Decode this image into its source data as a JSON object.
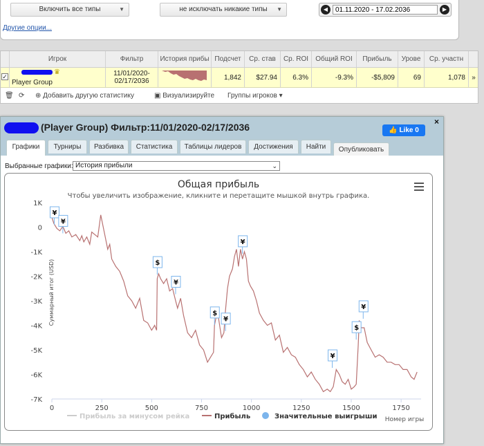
{
  "filters": {
    "types_label": "Включить все типы",
    "exclude_label": "не исключать никакие типы",
    "date_range": "01.11.2020 - 17.02.2036",
    "more_options": "Другие опции..."
  },
  "table": {
    "headers": [
      "Игрок",
      "Фильтр",
      "История прибы",
      "Подсчет",
      "Ср. став",
      "Ср. ROI",
      "Общий ROI",
      "Прибыль",
      "Урове",
      "Ср. участн"
    ],
    "row": {
      "player": "Player Group",
      "filter_line1": "11/01/2020-",
      "filter_line2": "02/17/2036",
      "count": "1,842",
      "avg_stake": "$27.94",
      "avg_roi": "6.3%",
      "total_roi": "-9.3%",
      "profit": "-$5,809",
      "level": "69",
      "avg_entrants": "1,078",
      "extra": "»"
    },
    "toolbar": {
      "add_stat": "Добавить другую статистику",
      "visualize": "Визуализируйте",
      "groups": "Группы игроков"
    }
  },
  "window": {
    "title": "(Player Group) Фильтр:11/01/2020-02/17/2036",
    "like_label": "Like 0",
    "close": "×",
    "tabs": [
      "Графики",
      "Турниры",
      "Разбивка",
      "Статистика",
      "Таблицы лидеров",
      "Достижения",
      "Найти"
    ],
    "publish": "Опубликовать",
    "selected_label": "Выбранные графики:",
    "selected_value": "История прибыли"
  },
  "colors": {
    "line": "#b87171",
    "rake_line": "#cccccc",
    "marker": "#7cb5ec",
    "accent": "#1877f2"
  },
  "chart_data": {
    "type": "line",
    "title": "Общая прибыль",
    "subtitle": "Чтобы увеличить изображение, кликните и перетащите мышкой внутрь графика.",
    "xlabel": "Номер игры",
    "ylabel": "Суммарный итог (USD)",
    "xlim": [
      0,
      1850
    ],
    "ylim": [
      -7000,
      1000
    ],
    "xticks": [
      "0",
      "250",
      "500",
      "750",
      "1000",
      "1250",
      "1500",
      "1750"
    ],
    "xtick_values": [
      0,
      250,
      500,
      750,
      1000,
      1250,
      1500,
      1750
    ],
    "yticks": [
      "1K",
      "0",
      "-1K",
      "-2K",
      "-3K",
      "-4K",
      "-5K",
      "-6K",
      "-7K"
    ],
    "ytick_values": [
      1000,
      0,
      -1000,
      -2000,
      -3000,
      -4000,
      -5000,
      -6000,
      -7000
    ],
    "series": [
      {
        "name": "Прибыль",
        "x": [
          0,
          10,
          25,
          40,
          55,
          70,
          85,
          100,
          120,
          140,
          150,
          160,
          175,
          190,
          200,
          215,
          230,
          245,
          255,
          265,
          280,
          290,
          300,
          320,
          340,
          360,
          380,
          400,
          420,
          440,
          460,
          480,
          500,
          515,
          525,
          528,
          535,
          545,
          560,
          575,
          590,
          605,
          620,
          630,
          645,
          660,
          680,
          700,
          720,
          740,
          760,
          780,
          795,
          810,
          815,
          822,
          835,
          850,
          862,
          870,
          880,
          890,
          905,
          915,
          925,
          935,
          945,
          955,
          965,
          975,
          985,
          995,
          1010,
          1025,
          1040,
          1060,
          1080,
          1100,
          1120,
          1140,
          1160,
          1180,
          1200,
          1220,
          1240,
          1260,
          1280,
          1300,
          1320,
          1340,
          1360,
          1380,
          1395,
          1410,
          1425,
          1440,
          1455,
          1470,
          1485,
          1500,
          1515,
          1525,
          1535,
          1540,
          1550,
          1565,
          1580,
          1600,
          1620,
          1640,
          1660,
          1680,
          1700,
          1720,
          1740,
          1760,
          1780,
          1800,
          1815,
          1830
        ],
        "values": [
          400,
          150,
          -50,
          -150,
          30,
          -250,
          -150,
          -400,
          -300,
          -550,
          -350,
          -600,
          -400,
          -700,
          -200,
          -300,
          -400,
          500,
          100,
          -300,
          -900,
          -700,
          -1300,
          -1600,
          -1800,
          -2200,
          -2800,
          -3000,
          -3300,
          -2900,
          -3800,
          -3900,
          -4200,
          -4000,
          -4200,
          -2100,
          -1900,
          -2100,
          -2300,
          -2100,
          -2600,
          -2500,
          -3000,
          -3300,
          -2900,
          -3600,
          -4300,
          -4500,
          -4200,
          -4800,
          -5000,
          -5500,
          -5300,
          -5100,
          -4000,
          -3700,
          -3700,
          -4500,
          -4300,
          -3400,
          -2500,
          -2000,
          -1700,
          -1200,
          -900,
          -1600,
          -900,
          -1300,
          -1000,
          -1300,
          -2200,
          -2400,
          -2600,
          -3000,
          -3500,
          -3800,
          -4000,
          -3900,
          -4600,
          -4400,
          -5100,
          -4900,
          -5200,
          -5300,
          -5600,
          -5800,
          -6100,
          -5900,
          -6200,
          -6400,
          -6700,
          -6600,
          -6700,
          -6500,
          -5800,
          -6000,
          -6300,
          -6400,
          -6200,
          -6600,
          -6500,
          -6400,
          -4800,
          -3800,
          -4100,
          -4100,
          -4700,
          -5000,
          -5300,
          -5200,
          -5300,
          -5500,
          -5500,
          -5600,
          -5600,
          -5800,
          -5800,
          -6100,
          -6200,
          -5900
        ]
      }
    ],
    "markers": [
      {
        "x": 12,
        "y": 380,
        "label": "¥"
      },
      {
        "x": 55,
        "y": 30,
        "label": "¥"
      },
      {
        "x": 528,
        "y": -1650,
        "label": "$"
      },
      {
        "x": 620,
        "y": -2450,
        "label": "¥"
      },
      {
        "x": 815,
        "y": -3700,
        "label": "$"
      },
      {
        "x": 870,
        "y": -3950,
        "label": "¥"
      },
      {
        "x": 955,
        "y": -800,
        "label": "¥"
      },
      {
        "x": 1405,
        "y": -5450,
        "label": "¥"
      },
      {
        "x": 1525,
        "y": -4300,
        "label": "$"
      },
      {
        "x": 1560,
        "y": -3450,
        "label": "¥"
      }
    ],
    "legend": [
      {
        "name": "Прибыль за минусом рейка",
        "type": "line"
      },
      {
        "name": "Прибыль",
        "type": "line"
      },
      {
        "name": "Значительные выигрыши",
        "type": "dot"
      }
    ],
    "legend_position": "bottom",
    "grid": false
  }
}
